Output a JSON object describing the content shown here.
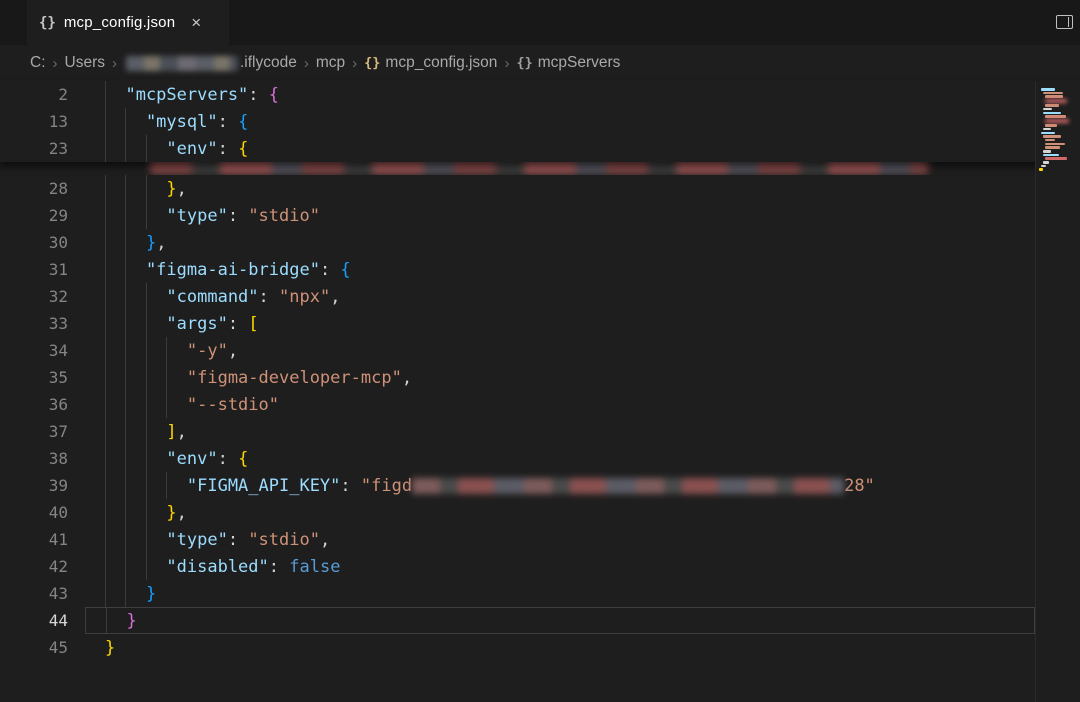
{
  "colors": {
    "editor_bg": "#1e1e1e",
    "tabbar_bg": "#181818",
    "key": "#9cdcfe",
    "string": "#ce9178",
    "bracket_gold": "#ffd700",
    "bracket_pink": "#da70d6",
    "bracket_blue": "#179fff",
    "keyword": "#569cd6"
  },
  "tab_bar": {
    "active_tab": {
      "icon": "braces-file-icon",
      "icon_glyph": "{}",
      "label": "mcp_config.json",
      "close_glyph": "×"
    },
    "top_right_icon": "split-editor"
  },
  "breadcrumb": {
    "separator": "›",
    "items": [
      {
        "label": "C:"
      },
      {
        "label": "Users"
      },
      {
        "redacted": true,
        "width": 112
      },
      {
        "label": ".iflycode",
        "no_sep": true
      },
      {
        "label": "mcp"
      },
      {
        "label": "mcp_config.json",
        "icon": "{}",
        "icon_class": "gold"
      },
      {
        "label": "mcpServers",
        "icon": "{}",
        "icon_class": "gray"
      }
    ]
  },
  "editor": {
    "current_line": 44,
    "sticky_lines": [
      {
        "n": 2,
        "i": 1,
        "t": [
          [
            "k",
            "\"mcpServers\""
          ],
          [
            "p",
            ": "
          ],
          [
            "b2",
            "{"
          ]
        ]
      },
      {
        "n": 13,
        "i": 2,
        "t": [
          [
            "k",
            "\"mysql\""
          ],
          [
            "p",
            ": "
          ],
          [
            "b3",
            "{"
          ]
        ]
      },
      {
        "n": 23,
        "i": 3,
        "t": [
          [
            "k",
            "\"env\""
          ],
          [
            "p",
            ": "
          ],
          [
            "b1",
            "{"
          ]
        ]
      }
    ],
    "hidden_line": {
      "redacted_width": 778
    },
    "lines": [
      {
        "n": 28,
        "i": 3,
        "t": [
          [
            "b1",
            "}"
          ],
          [
            "p",
            ","
          ]
        ]
      },
      {
        "n": 29,
        "i": 3,
        "t": [
          [
            "k",
            "\"type\""
          ],
          [
            "p",
            ": "
          ],
          [
            "s",
            "\"stdio\""
          ]
        ]
      },
      {
        "n": 30,
        "i": 2,
        "t": [
          [
            "b3",
            "}"
          ],
          [
            "p",
            ","
          ]
        ]
      },
      {
        "n": 31,
        "i": 2,
        "t": [
          [
            "k",
            "\"figma-ai-bridge\""
          ],
          [
            "p",
            ": "
          ],
          [
            "b3",
            "{"
          ]
        ]
      },
      {
        "n": 32,
        "i": 3,
        "t": [
          [
            "k",
            "\"command\""
          ],
          [
            "p",
            ": "
          ],
          [
            "s",
            "\"npx\""
          ],
          [
            "p",
            ","
          ]
        ]
      },
      {
        "n": 33,
        "i": 3,
        "t": [
          [
            "k",
            "\"args\""
          ],
          [
            "p",
            ": "
          ],
          [
            "b1",
            "["
          ]
        ]
      },
      {
        "n": 34,
        "i": 4,
        "t": [
          [
            "s",
            "\"-y\""
          ],
          [
            "p",
            ","
          ]
        ]
      },
      {
        "n": 35,
        "i": 4,
        "t": [
          [
            "s",
            "\"figma-developer-mcp\""
          ],
          [
            "p",
            ","
          ]
        ]
      },
      {
        "n": 36,
        "i": 4,
        "t": [
          [
            "s",
            "\"--stdio\""
          ]
        ]
      },
      {
        "n": 37,
        "i": 3,
        "t": [
          [
            "b1",
            "]"
          ],
          [
            "p",
            ","
          ]
        ]
      },
      {
        "n": 38,
        "i": 3,
        "t": [
          [
            "k",
            "\"env\""
          ],
          [
            "p",
            ": "
          ],
          [
            "b1",
            "{"
          ]
        ]
      },
      {
        "n": 39,
        "i": 4,
        "t": [
          [
            "k",
            "\"FIGMA_API_KEY\""
          ],
          [
            "p",
            ": "
          ],
          [
            "s",
            "\"figd"
          ],
          [
            "r",
            432
          ],
          [
            "s",
            "28\""
          ]
        ]
      },
      {
        "n": 40,
        "i": 3,
        "t": [
          [
            "b1",
            "}"
          ],
          [
            "p",
            ","
          ]
        ]
      },
      {
        "n": 41,
        "i": 3,
        "t": [
          [
            "k",
            "\"type\""
          ],
          [
            "p",
            ": "
          ],
          [
            "s",
            "\"stdio\""
          ],
          [
            "p",
            ","
          ]
        ]
      },
      {
        "n": 42,
        "i": 3,
        "t": [
          [
            "k",
            "\"disabled\""
          ],
          [
            "p",
            ": "
          ],
          [
            "kw",
            "false"
          ]
        ]
      },
      {
        "n": 43,
        "i": 2,
        "t": [
          [
            "b3",
            "}"
          ]
        ]
      },
      {
        "n": 44,
        "i": 1,
        "t": [
          [
            "b2",
            "}"
          ]
        ]
      },
      {
        "n": 45,
        "i": 0,
        "t": [
          [
            "b1",
            "}"
          ]
        ]
      }
    ]
  },
  "minimap": {
    "palette": [
      "#c586c0",
      "#9cdcfe",
      "#ce9178",
      "#ffd700",
      "#569cd6",
      "#6a9955",
      "#d16969",
      "#d4d4d4"
    ],
    "rows": [
      [
        2,
        14,
        1,
        0
      ],
      [
        4,
        20,
        2,
        0
      ],
      [
        6,
        18,
        2,
        0
      ],
      [
        6,
        22,
        6,
        1
      ],
      [
        6,
        14,
        2,
        0
      ],
      [
        4,
        9,
        7,
        0
      ],
      [
        4,
        18,
        1,
        0
      ],
      [
        6,
        21,
        2,
        0
      ],
      [
        6,
        24,
        6,
        1
      ],
      [
        6,
        12,
        2,
        0
      ],
      [
        4,
        8,
        7,
        0
      ],
      [
        2,
        14,
        1,
        0
      ],
      [
        4,
        18,
        2,
        0
      ],
      [
        6,
        10,
        2,
        0
      ],
      [
        6,
        20,
        2,
        0
      ],
      [
        6,
        15,
        2,
        0
      ],
      [
        4,
        8,
        7,
        0
      ],
      [
        4,
        16,
        1,
        0
      ],
      [
        6,
        22,
        6,
        0
      ],
      [
        4,
        6,
        7,
        0
      ],
      [
        2,
        5,
        7,
        0
      ],
      [
        0,
        4,
        3,
        0
      ]
    ]
  }
}
